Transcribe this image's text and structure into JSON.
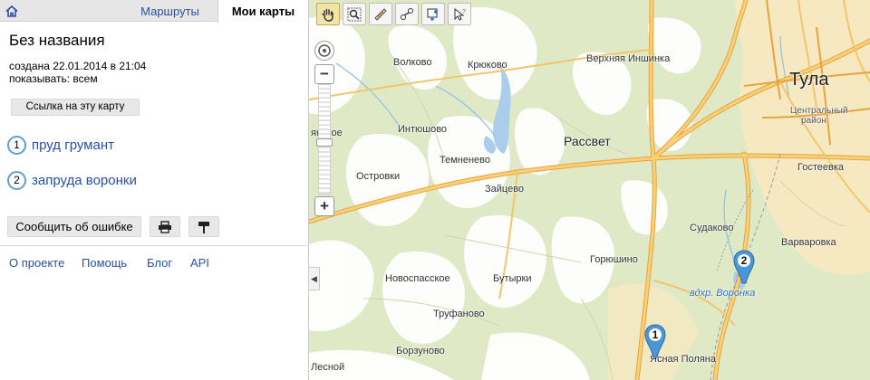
{
  "tabs": {
    "routes": "Маршруты",
    "my_maps": "Мои карты"
  },
  "map_info": {
    "title": "Без названия",
    "created": "создана 22.01.2014 в 21:04",
    "shown_to": "показывать: всем"
  },
  "link_button": "Ссылка на эту карту",
  "points": [
    {
      "number": "1",
      "label": "пруд грумант"
    },
    {
      "number": "2",
      "label": "запруда воронки"
    }
  ],
  "report_button": "Сообщить об ошибке",
  "footer_links": {
    "about": "О проекте",
    "help": "Помощь",
    "blog": "Блог",
    "api": "API"
  },
  "map": {
    "places": {
      "volkovo": "Волково",
      "kryukovo": "Крюково",
      "verkhnyaya_inshinka": "Верхняя Иншинка",
      "tula": "Тула",
      "intyushovo": "Интюшово",
      "rassvet": "Рассвет",
      "temnenevo": "Темненево",
      "ostrovki": "Островки",
      "zaytsevo": "Зайцево",
      "gosteevka": "Гостеевка",
      "sudakovo": "Судаково",
      "varvarovka": "Варваровка",
      "goryushino": "Горюшино",
      "novospasskoe": "Новоспасское",
      "butyrki": "Бутырки",
      "trufanovo": "Труфаново",
      "borzunovo": "Борзуново",
      "lesnoy": "Лесной",
      "yasnaya_polyana": "Ясная Поляна",
      "voronka": "вдхр. Воронка",
      "yanskoe_partial": "янское",
      "central_district_1": "Центральный",
      "central_district_2": "район"
    },
    "markers": [
      {
        "number": "1"
      },
      {
        "number": "2"
      }
    ]
  },
  "colors": {
    "link": "#2b4fa6",
    "road": "#f4b94a",
    "forest": "#ffffff",
    "field": "#dfe9c6",
    "city": "#f6e9c2",
    "water": "#a9cdea"
  }
}
